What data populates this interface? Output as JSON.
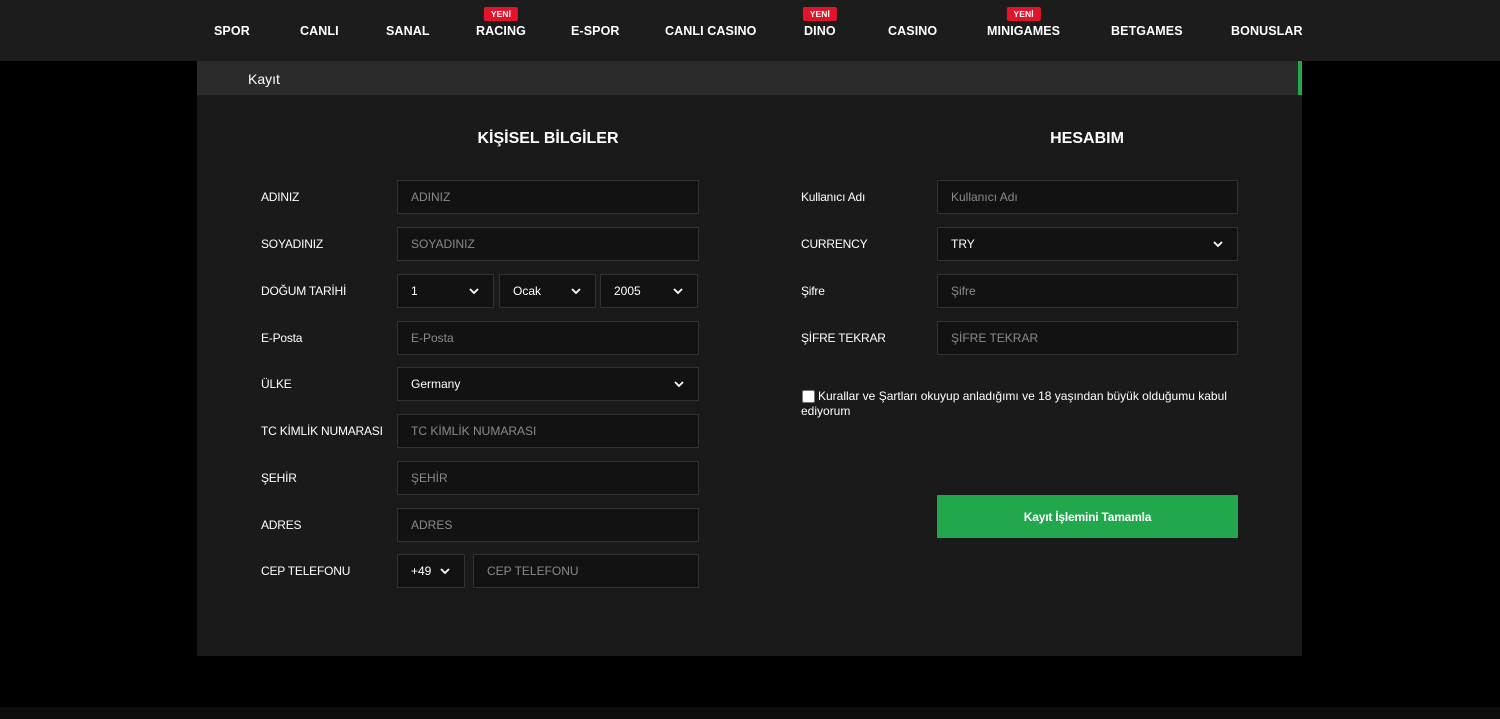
{
  "nav": {
    "items": [
      {
        "label": "SPOR",
        "badge": ""
      },
      {
        "label": "CANLI",
        "badge": ""
      },
      {
        "label": "SANAL",
        "badge": ""
      },
      {
        "label": "RACING",
        "badge": "YENİ"
      },
      {
        "label": "E-SPOR",
        "badge": ""
      },
      {
        "label": "CANLI CASINO",
        "badge": ""
      },
      {
        "label": "DINO",
        "badge": "YENİ"
      },
      {
        "label": "CASINO",
        "badge": ""
      },
      {
        "label": "MINIGAMES",
        "badge": "YENİ"
      },
      {
        "label": "BETGAMES",
        "badge": ""
      },
      {
        "label": "BONUSLAR",
        "badge": ""
      }
    ]
  },
  "panel": {
    "title": "Kayıt"
  },
  "personal": {
    "title": "KİŞİSEL BİLGİLER",
    "first_name": {
      "label": "ADINIZ",
      "placeholder": "ADINIZ",
      "value": ""
    },
    "last_name": {
      "label": "SOYADINIZ",
      "placeholder": "SOYADINIZ",
      "value": ""
    },
    "birth_date": {
      "label": "DOĞUM TARİHİ",
      "day": "1",
      "month": "Ocak",
      "year": "2005"
    },
    "email": {
      "label": "E-Posta",
      "placeholder": "E-Posta",
      "value": ""
    },
    "country": {
      "label": "ÜLKE",
      "value": "Germany"
    },
    "tc_id": {
      "label": "TC KİMLİK NUMARASI",
      "placeholder": "TC KİMLİK NUMARASI",
      "value": ""
    },
    "city": {
      "label": "ŞEHİR",
      "placeholder": "ŞEHİR",
      "value": ""
    },
    "address": {
      "label": "ADRES",
      "placeholder": "ADRES",
      "value": ""
    },
    "phone": {
      "label": "CEP TELEFONU",
      "code": "+49",
      "placeholder": "CEP TELEFONU",
      "value": ""
    }
  },
  "account": {
    "title": "HESABIM",
    "username": {
      "label": "Kullanıcı Adı",
      "placeholder": "Kullanıcı Adı",
      "value": ""
    },
    "currency": {
      "label": "CURRENCY",
      "value": "TRY"
    },
    "password": {
      "label": "Şifre",
      "placeholder": "Şifre",
      "value": ""
    },
    "password_repeat": {
      "label": "ŞİFRE TEKRAR",
      "placeholder": "ŞİFRE TEKRAR",
      "value": ""
    },
    "terms": {
      "text": "Kurallar ve Şartları okuyup anladığımı ve 18 yaşından büyük olduğumu kabul ediyorum",
      "checked": false
    },
    "submit_label": "Kayıt İşlemini Tamamla"
  },
  "colors": {
    "accent_green": "#21a84c",
    "badge_red": "#e3132b",
    "panel_bg": "#1a1a1a",
    "input_bg": "#121212"
  },
  "icons": {
    "select_arrow": "chevron-down-icon"
  }
}
